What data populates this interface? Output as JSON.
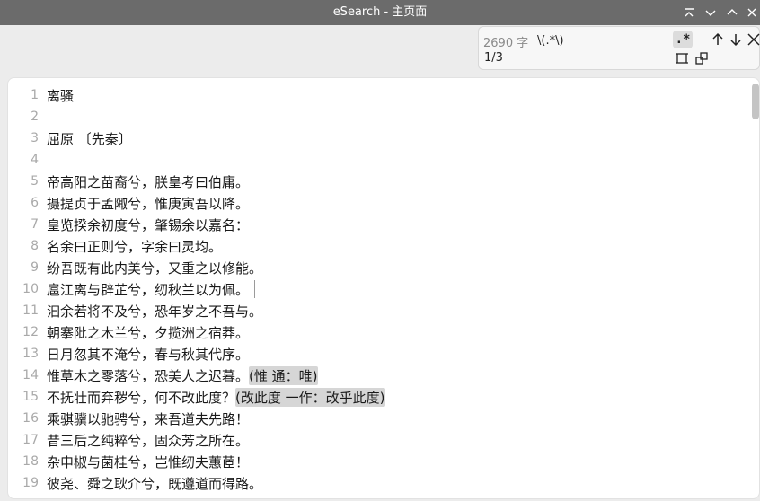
{
  "window": {
    "title": "eSearch - 主页面"
  },
  "search": {
    "char_count": "2690 字",
    "query": "\\(.*\\)",
    "match_position": "1/3",
    "regex_label": ".*"
  },
  "editor": {
    "lines": [
      {
        "n": "1",
        "text": "离骚",
        "hl": ""
      },
      {
        "n": "2",
        "text": "",
        "hl": ""
      },
      {
        "n": "3",
        "text": "屈原 〔先秦〕",
        "hl": ""
      },
      {
        "n": "4",
        "text": "",
        "hl": ""
      },
      {
        "n": "5",
        "text": "帝高阳之苗裔兮，朕皇考曰伯庸。",
        "hl": ""
      },
      {
        "n": "6",
        "text": "摄提贞于孟陬兮，惟庚寅吾以降。",
        "hl": ""
      },
      {
        "n": "7",
        "text": "皇览揆余初度兮，肇锡余以嘉名：",
        "hl": ""
      },
      {
        "n": "8",
        "text": "名余曰正则兮，字余曰灵均。",
        "hl": ""
      },
      {
        "n": "9",
        "text": "纷吾既有此内美兮，又重之以修能。",
        "hl": ""
      },
      {
        "n": "10",
        "text": "扈江离与辟芷兮，纫秋兰以为佩。",
        "hl": ""
      },
      {
        "n": "11",
        "text": "汩余若将不及兮，恐年岁之不吾与。",
        "hl": ""
      },
      {
        "n": "12",
        "text": "朝搴阰之木兰兮，夕揽洲之宿莽。",
        "hl": ""
      },
      {
        "n": "13",
        "text": "日月忽其不淹兮，春与秋其代序。",
        "hl": ""
      },
      {
        "n": "14",
        "text": "惟草木之零落兮，恐美人之迟暮。",
        "hl": "(惟 通：唯)"
      },
      {
        "n": "15",
        "text": "不抚壮而弃秽兮，何不改此度？",
        "hl": "(改此度 一作：改乎此度)"
      },
      {
        "n": "16",
        "text": "乘骐骥以驰骋兮，来吾道夫先路！",
        "hl": ""
      },
      {
        "n": "17",
        "text": "昔三后之纯粹兮，固众芳之所在。",
        "hl": ""
      },
      {
        "n": "18",
        "text": "杂申椒与菌桂兮，岂惟纫夫蕙茝！",
        "hl": ""
      },
      {
        "n": "19",
        "text": "彼尧、舜之耿介兮，既遵道而得路。",
        "hl": ""
      }
    ]
  }
}
